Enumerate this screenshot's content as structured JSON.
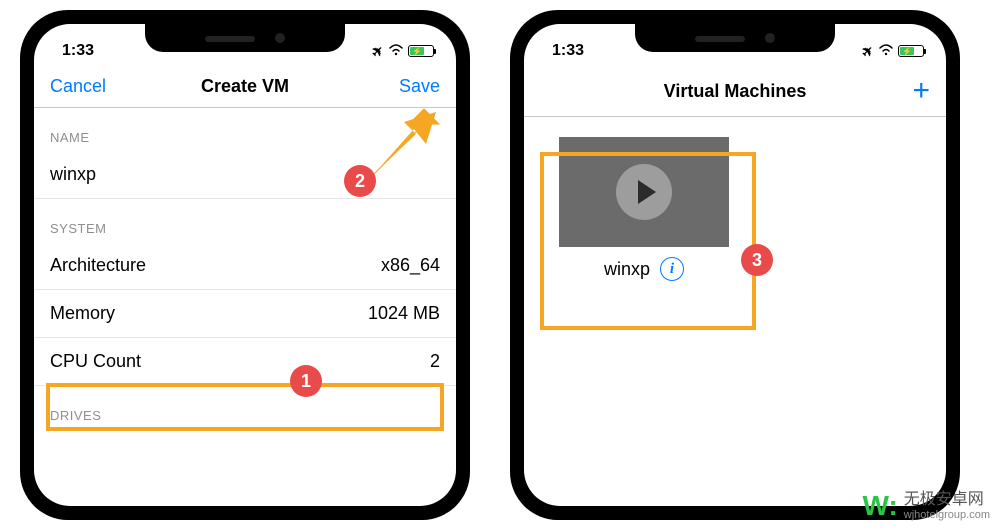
{
  "statusbar": {
    "time": "1:33"
  },
  "phone1": {
    "nav": {
      "left": "Cancel",
      "title": "Create VM",
      "right": "Save"
    },
    "sections": {
      "name_header": "NAME",
      "name_value": "winxp",
      "system_header": "SYSTEM",
      "arch_label": "Architecture",
      "arch_value": "x86_64",
      "mem_label": "Memory",
      "mem_value": "1024  MB",
      "cpu_label": "CPU Count",
      "cpu_value": "2",
      "drives_header": "DRIVES"
    }
  },
  "phone2": {
    "nav": {
      "title": "Virtual Machines"
    },
    "vm": {
      "name": "winxp"
    }
  },
  "badges": {
    "b1": "1",
    "b2": "2",
    "b3": "3"
  },
  "watermark": {
    "cn": "无极安卓网",
    "url": "wjhotelgroup.com"
  }
}
